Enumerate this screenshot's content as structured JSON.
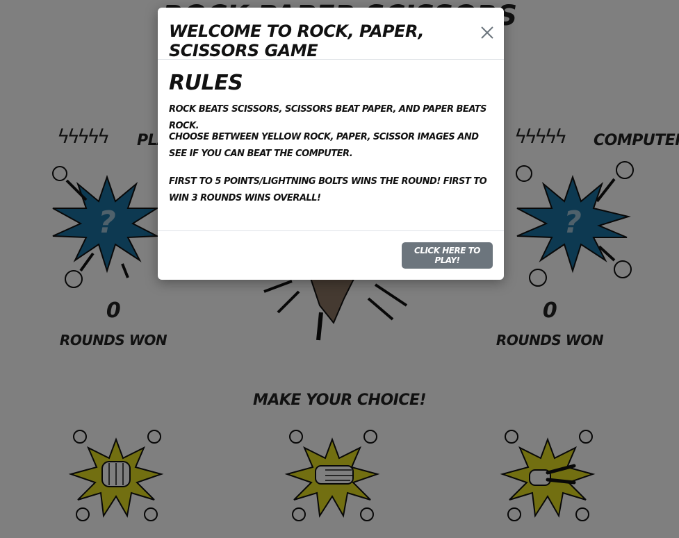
{
  "page": {
    "title": "Rock Paper Scissors",
    "player_label": "Player",
    "computer_label": "Computer",
    "player_bolts": "ϟϟϟϟϟ",
    "computer_bolts": "ϟϟϟϟϟ",
    "player_score": "0",
    "computer_score": "0",
    "rounds_label": "Rounds Won",
    "choice_heading": "Make your choice!",
    "unknown_mark": "?"
  },
  "modal": {
    "title": "Welcome to Rock, Paper, Scissors Game",
    "rules_title": "Rules",
    "rules": [
      "Rock beats scissors, scissors beat paper, and paper beats rock.",
      "Choose between yellow rock, paper, scissor images and see if you can beat the computer.",
      "First to 5 points/lightning bolts wins the round! First to win 3 rounds wins overall!"
    ],
    "play_button": "Click here to play!"
  },
  "colors": {
    "backdrop": "rgba(0,0,0,0.5)",
    "unknown_burst": "#1b73a3",
    "choice_burst": "#e5df22",
    "play_button": "#6c757d"
  }
}
